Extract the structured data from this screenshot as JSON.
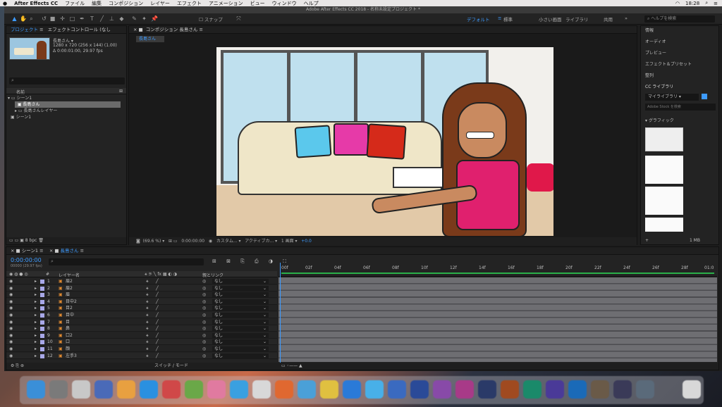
{
  "menubar": {
    "app": "After Effects CC",
    "items": [
      "ファイル",
      "編集",
      "コンポジション",
      "レイヤー",
      "エフェクト",
      "アニメーション",
      "ビュー",
      "ウィンドウ",
      "ヘルプ"
    ],
    "time": "18:28"
  },
  "window_title": "Adobe After Effects CC 2018 - 名称未設定プロジェクト *",
  "toolbar": {
    "snap": "スナップ",
    "workspaces": [
      "デフォルト",
      "標準",
      "小さい画面",
      "ライブラリ",
      "共用"
    ],
    "search_placeholder": "ヘルプを検索"
  },
  "project": {
    "tab": "プロジェクト",
    "tab2": "エフェクトコントロール (なし",
    "comp_name": "長島さん ▾",
    "comp_size": "1280 x 720 (256 x 144) (1.00)",
    "comp_dur": "Δ 0:00:01:00, 29.97 fps",
    "col_name": "名前",
    "items": [
      "シーン1",
      "長島さん",
      "長島さんレイヤー",
      "シーン1"
    ],
    "bpc": "8 bpc"
  },
  "comp": {
    "tab": "コンポジション 長島さん",
    "sub": "長島さん",
    "zoom": "(69.6 %)",
    "time": "0:00:00:00",
    "camera": "カスタム...",
    "view": "アクティブカ...",
    "views": "1 画面",
    "exposure": "+0.0"
  },
  "right": {
    "items": [
      "情報",
      "オーディオ",
      "プレビュー",
      "エフェクト＆プリセット",
      "整列"
    ],
    "cc": "CC ライブラリ",
    "lib": "マイライブラリ",
    "stock": "Adobe Stock を検索",
    "graphics": "グラフィック",
    "size": "1 MB"
  },
  "timeline": {
    "tab1": "シーン1",
    "tab2": "長島さん",
    "time": "0:00:00:00",
    "fps": "00000 (29.97 fps)",
    "col_layer": "レイヤー名",
    "col_parent": "親とリンク",
    "switch": "スイッチ / モード",
    "ruler": [
      "00f",
      "02f",
      "04f",
      "06f",
      "08f",
      "10f",
      "12f",
      "14f",
      "16f",
      "18f",
      "20f",
      "22f",
      "24f",
      "26f",
      "28f",
      "01:0"
    ],
    "layers": [
      {
        "n": "1",
        "name": "眉2",
        "p": "なし"
      },
      {
        "n": "2",
        "name": "眉2",
        "p": "なし"
      },
      {
        "n": "3",
        "name": "眉",
        "p": "なし"
      },
      {
        "n": "4",
        "name": "目中2",
        "p": "なし"
      },
      {
        "n": "5",
        "name": "目2",
        "p": "なし"
      },
      {
        "n": "6",
        "name": "目中",
        "p": "なし"
      },
      {
        "n": "7",
        "name": "目",
        "p": "なし"
      },
      {
        "n": "8",
        "name": "鼻",
        "p": "なし"
      },
      {
        "n": "9",
        "name": "口2",
        "p": "なし"
      },
      {
        "n": "10",
        "name": "口",
        "p": "なし"
      },
      {
        "n": "11",
        "name": "顔",
        "p": "なし"
      },
      {
        "n": "12",
        "name": "左手3",
        "p": "なし"
      }
    ]
  }
}
